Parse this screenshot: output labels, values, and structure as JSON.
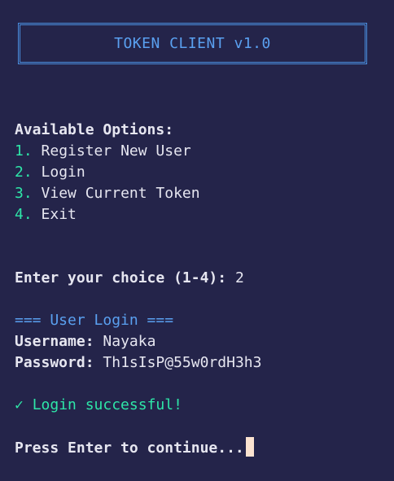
{
  "banner": {
    "title": "TOKEN CLIENT v1.0"
  },
  "menu": {
    "heading": "Available Options:",
    "items": [
      {
        "num": "1.",
        "label": "Register New User"
      },
      {
        "num": "2.",
        "label": "Login"
      },
      {
        "num": "3.",
        "label": "View Current Token"
      },
      {
        "num": "4.",
        "label": "Exit"
      }
    ]
  },
  "prompt": {
    "label": "Enter your choice (1-4):",
    "value": "2"
  },
  "login": {
    "heading": "=== User Login ===",
    "username_label": "Username:",
    "username_value": "Nayaka",
    "password_label": "Password:",
    "password_value": "Th1sIsP@55w0rdH3h3"
  },
  "result": {
    "check": "✓",
    "message": "Login successful!"
  },
  "continue": {
    "text": "Press Enter to continue..."
  },
  "colors": {
    "background": "#24244a",
    "accent_blue": "#5aa0f0",
    "accent_green": "#2ee6a8",
    "cursor": "#fbe3d0"
  }
}
